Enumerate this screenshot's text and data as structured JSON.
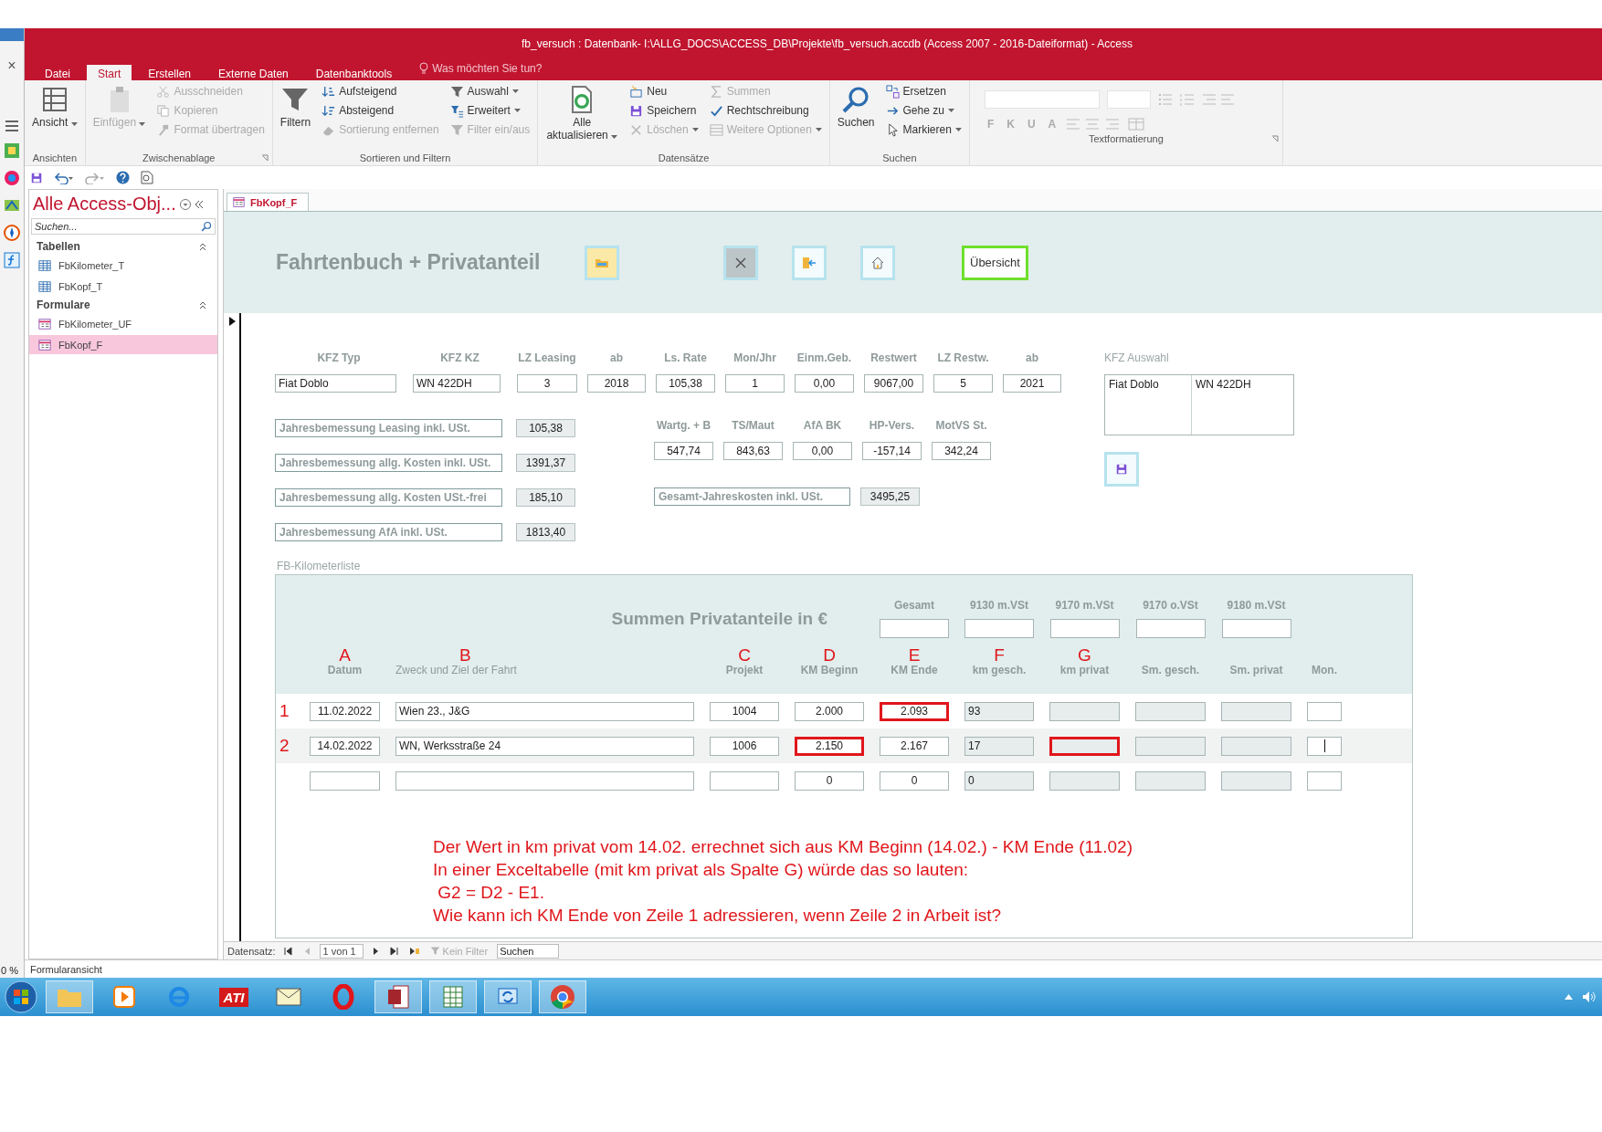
{
  "window": {
    "title": "fb_versuch : Datenbank- I:\\ALLG_DOCS\\ACCESS_DB\\Projekte\\fb_versuch.accdb (Access 2007 - 2016-Dateiformat) - Access"
  },
  "left_strip": {
    "close_glyph": "×",
    "zoom": "0 %"
  },
  "menu_tabs": [
    {
      "label": "Datei",
      "selected": false
    },
    {
      "label": "Start",
      "selected": true
    },
    {
      "label": "Erstellen",
      "selected": false
    },
    {
      "label": "Externe Daten",
      "selected": false
    },
    {
      "label": "Datenbanktools",
      "selected": false
    }
  ],
  "tell_me": "Was möchten Sie tun?",
  "ribbon": {
    "groups": [
      {
        "label": "Ansichten",
        "launcher": false,
        "columns": [
          {
            "kind": "large",
            "items": [
              {
                "label": "Ansicht",
                "disabled": false,
                "dropdown": true
              }
            ]
          }
        ]
      },
      {
        "label": "Zwischenablage",
        "launcher": true,
        "columns": [
          {
            "kind": "large",
            "items": [
              {
                "label": "Einfügen",
                "disabled": true,
                "dropdown": true
              }
            ]
          },
          {
            "kind": "small",
            "items": [
              {
                "label": "Ausschneiden",
                "disabled": true,
                "dropdown": false
              },
              {
                "label": "Kopieren",
                "disabled": true,
                "dropdown": false
              },
              {
                "label": "Format übertragen",
                "disabled": true,
                "dropdown": false
              }
            ]
          }
        ]
      },
      {
        "label": "Sortieren und Filtern",
        "launcher": false,
        "columns": [
          {
            "kind": "large",
            "items": [
              {
                "label": "Filtern",
                "disabled": false,
                "dropdown": false
              }
            ]
          },
          {
            "kind": "small",
            "items": [
              {
                "label": "Aufsteigend",
                "disabled": false,
                "dropdown": false
              },
              {
                "label": "Absteigend",
                "disabled": false,
                "dropdown": false
              },
              {
                "label": "Sortierung entfernen",
                "disabled": true,
                "dropdown": false
              }
            ]
          },
          {
            "kind": "small",
            "items": [
              {
                "label": "Auswahl",
                "disabled": false,
                "dropdown": true
              },
              {
                "label": "Erweitert",
                "disabled": false,
                "dropdown": true
              },
              {
                "label": "Filter ein/aus",
                "disabled": true,
                "dropdown": false
              }
            ]
          }
        ]
      },
      {
        "label": "Datensätze",
        "launcher": false,
        "columns": [
          {
            "kind": "large",
            "items": [
              {
                "label": "Alle aktualisieren",
                "disabled": false,
                "dropdown": true
              }
            ]
          },
          {
            "kind": "small",
            "items": [
              {
                "label": "Neu",
                "disabled": false,
                "dropdown": false
              },
              {
                "label": "Speichern",
                "disabled": false,
                "dropdown": false
              },
              {
                "label": "Löschen",
                "disabled": true,
                "dropdown": true
              }
            ]
          },
          {
            "kind": "small",
            "items": [
              {
                "label": "Summen",
                "disabled": true,
                "dropdown": false
              },
              {
                "label": "Rechtschreibung",
                "disabled": false,
                "dropdown": false
              },
              {
                "label": "Weitere Optionen",
                "disabled": true,
                "dropdown": true
              }
            ]
          }
        ]
      },
      {
        "label": "Suchen",
        "launcher": false,
        "columns": [
          {
            "kind": "large",
            "items": [
              {
                "label": "Suchen",
                "disabled": false,
                "dropdown": false
              }
            ]
          },
          {
            "kind": "small",
            "items": [
              {
                "label": "Ersetzen",
                "disabled": false,
                "dropdown": false
              },
              {
                "label": "Gehe zu",
                "disabled": false,
                "dropdown": true
              },
              {
                "label": "Markieren",
                "disabled": false,
                "dropdown": true
              }
            ]
          }
        ]
      },
      {
        "label": "Textformatierung",
        "launcher": true,
        "kind": "format",
        "style_buttons": [
          "F",
          "K",
          "U",
          "A"
        ]
      }
    ]
  },
  "nav_pane": {
    "title": "Alle Access-Obj...",
    "search": {
      "placeholder": "Suchen..."
    },
    "groups": [
      {
        "label": "Tabellen",
        "items": [
          {
            "label": "FbKilometer_T",
            "kind": "table",
            "selected": false
          },
          {
            "label": "FbKopf_T",
            "kind": "table",
            "selected": false
          }
        ]
      },
      {
        "label": "Formulare",
        "items": [
          {
            "label": "FbKilometer_UF",
            "kind": "form",
            "selected": false
          },
          {
            "label": "FbKopf_F",
            "kind": "form",
            "selected": true
          }
        ]
      }
    ]
  },
  "document_tab": {
    "label": "FbKopf_F"
  },
  "form": {
    "title": "Fahrtenbuch + Privatanteil",
    "overview_button": {
      "label": "Übersicht",
      "focused": true
    },
    "vehicle_fields": [
      {
        "label": "KFZ Typ",
        "value": "Fiat Doblo"
      },
      {
        "label": "KFZ KZ",
        "value": "WN 422DH"
      },
      {
        "label": "LZ Leasing",
        "value": "3"
      },
      {
        "label": "ab",
        "value": "2018"
      },
      {
        "label": "Ls. Rate",
        "value": "105,38"
      },
      {
        "label": "Mon/Jhr",
        "value": "1"
      },
      {
        "label": "Einm.Geb.",
        "value": "0,00"
      },
      {
        "label": "Restwert",
        "value": "9067,00"
      },
      {
        "label": "LZ Restw.",
        "value": "5"
      },
      {
        "label": "ab",
        "value": "2021"
      }
    ],
    "vehicle_choice": {
      "label": "KFZ Auswahl",
      "row": [
        "Fiat Doblo",
        "WN 422DH"
      ]
    },
    "annual_costs": [
      {
        "label": "Jahresbemessung Leasing inkl. USt.",
        "value": "105,38"
      },
      {
        "label": "Jahresbemessung allg. Kosten inkl. USt.",
        "value": "1391,37"
      },
      {
        "label": "Jahresbemessung allg. Kosten USt.-frei",
        "value": "185,10"
      },
      {
        "label": "Jahresbemessung AfA inkl. USt.",
        "value": "1813,40"
      }
    ],
    "cost_fields": [
      {
        "label": "Wartg. + B",
        "value": "547,74"
      },
      {
        "label": "TS/Maut",
        "value": "843,63"
      },
      {
        "label": "AfA BK",
        "value": "0,00"
      },
      {
        "label": "HP-Vers.",
        "value": "-157,14"
      },
      {
        "label": "MotVS St.",
        "value": "342,24"
      }
    ],
    "total": {
      "label": "Gesamt-Jahreskosten inkl. USt.",
      "value": "3495,25"
    },
    "subform": {
      "label": "FB-Kilometerliste",
      "sums_title": "Summen Privatanteile in €",
      "sums": [
        "Gesamt",
        "9130 m.VSt",
        "9170 m.VSt",
        "9170 o.VSt",
        "9180 m.VSt"
      ],
      "columns": [
        {
          "label": "Datum",
          "letter": "A",
          "calculated": false
        },
        {
          "label": "Zweck und Ziel der Fahrt",
          "letter": "B",
          "calculated": false
        },
        {
          "label": "Projekt",
          "letter": "C",
          "calculated": false
        },
        {
          "label": "KM Beginn",
          "letter": "D",
          "calculated": false
        },
        {
          "label": "KM Ende",
          "letter": "E",
          "calculated": false
        },
        {
          "label": "km gesch.",
          "letter": "F",
          "calculated": true
        },
        {
          "label": "km privat",
          "letter": "G",
          "calculated": true
        },
        {
          "label": "Sm. gesch.",
          "calculated": true
        },
        {
          "label": "Sm. privat",
          "calculated": true
        },
        {
          "label": "Mon.",
          "calculated": false
        }
      ],
      "rows": [
        {
          "number": "1",
          "cells": [
            {
              "value": "11.02.2022"
            },
            {
              "value": "Wien 23., J&G"
            },
            {
              "value": "1004"
            },
            {
              "value": "2.000"
            },
            {
              "value": "2.093",
              "highlighted": true
            },
            {
              "value": "93"
            },
            {},
            {},
            {},
            {}
          ]
        },
        {
          "number": "2",
          "cells": [
            {
              "value": "14.02.2022"
            },
            {
              "value": "WN, Werksstraße 24"
            },
            {
              "value": "1006"
            },
            {
              "value": "2.150",
              "highlighted": true
            },
            {
              "value": "2.167"
            },
            {
              "value": "17"
            },
            {
              "highlighted": true
            },
            {},
            {},
            {
              "focused": true
            }
          ]
        },
        {
          "cells": [
            {},
            {},
            {},
            {
              "value": "0"
            },
            {
              "value": "0"
            },
            {
              "value": "0"
            },
            {},
            {},
            {},
            {}
          ]
        }
      ],
      "annotation": [
        "Der Wert in km privat vom 14.02. errechnet sich aus KM Beginn (14.02.) - KM Ende (11.02)",
        "In einer Exceltabelle (mit km privat als Spalte G) würde das so lauten:",
        " G2 = D2 - E1.",
        "Wie kann ich KM Ende von Zeile 1 adressieren, wenn Zeile 2 in Arbeit ist?"
      ]
    }
  },
  "record_nav": {
    "label": "Datensatz:",
    "position": "1 von 1",
    "buttons": [
      {
        "kind": "first",
        "disabled": false
      },
      {
        "kind": "previous",
        "disabled": true
      },
      {
        "kind": "next",
        "disabled": false
      },
      {
        "kind": "last",
        "disabled": false
      },
      {
        "kind": "new",
        "disabled": false
      }
    ],
    "filter": {
      "label": "Kein Filter",
      "disabled": true
    },
    "search": {
      "placeholder": "Suchen"
    }
  },
  "status_bar": {
    "text": "Formularansicht"
  },
  "taskbar": {
    "ati_logo": "ATI"
  }
}
